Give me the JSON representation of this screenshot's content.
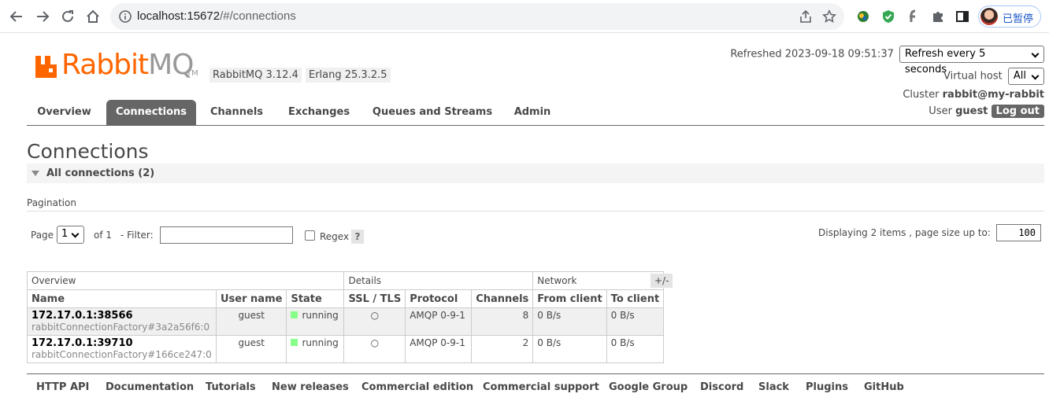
{
  "browser": {
    "url_host": "localhost:15672",
    "url_rest": "/#/connections",
    "profile_label": "已暂停"
  },
  "brand": {
    "logo_rabbit": "Rabbit",
    "logo_mq": "MQ",
    "logo_tm": "TM",
    "accent": "#ff6600",
    "version_badge": "RabbitMQ 3.12.4",
    "erlang_badge": "Erlang 25.3.2.5"
  },
  "status": {
    "refreshed_label": "Refreshed 2023-09-18 09:51:37",
    "refresh_select": "Refresh every 5 seconds",
    "vhost_label": "Virtual host",
    "vhost_select": "All",
    "cluster_label": "Cluster",
    "cluster_name": "rabbit@my-rabbit",
    "user_label": "User",
    "user_name": "guest",
    "logout_label": "Log out"
  },
  "tabs": [
    {
      "label": "Overview"
    },
    {
      "label": "Connections"
    },
    {
      "label": "Channels"
    },
    {
      "label": "Exchanges"
    },
    {
      "label": "Queues and Streams"
    },
    {
      "label": "Admin"
    }
  ],
  "page": {
    "title": "Connections",
    "section_label": "All connections (2)"
  },
  "pagination": {
    "title": "Pagination",
    "page_label": "Page",
    "page_value": "1",
    "of_label": "of 1",
    "filter_label": "- Filter:",
    "filter_value": "",
    "regex_label": "Regex",
    "help_label": "?",
    "display_text": "Displaying 2 items , page size up to:",
    "page_size": "100"
  },
  "table": {
    "groups": [
      "Overview",
      "Details",
      "Network"
    ],
    "columns": [
      "Name",
      "User name",
      "State",
      "SSL / TLS",
      "Protocol",
      "Channels",
      "From client",
      "To client"
    ],
    "toggle_label": "+/-",
    "rows": [
      {
        "name": "172.17.0.1:38566",
        "sub": "rabbitConnectionFactory#3a2a56f6:0",
        "user": "guest",
        "state": "running",
        "ssl": "○",
        "protocol": "AMQP 0-9-1",
        "channels": "8",
        "from_client": "0 B/s",
        "to_client": "0 B/s"
      },
      {
        "name": "172.17.0.1:39710",
        "sub": "rabbitConnectionFactory#166ce247:0",
        "user": "guest",
        "state": "running",
        "ssl": "○",
        "protocol": "AMQP 0-9-1",
        "channels": "2",
        "from_client": "0 B/s",
        "to_client": "0 B/s"
      }
    ]
  },
  "footer": [
    "HTTP API",
    "Documentation",
    "Tutorials",
    "New releases",
    "Commercial edition",
    "Commercial support",
    "Google Group",
    "Discord",
    "Slack",
    "Plugins",
    "GitHub"
  ]
}
